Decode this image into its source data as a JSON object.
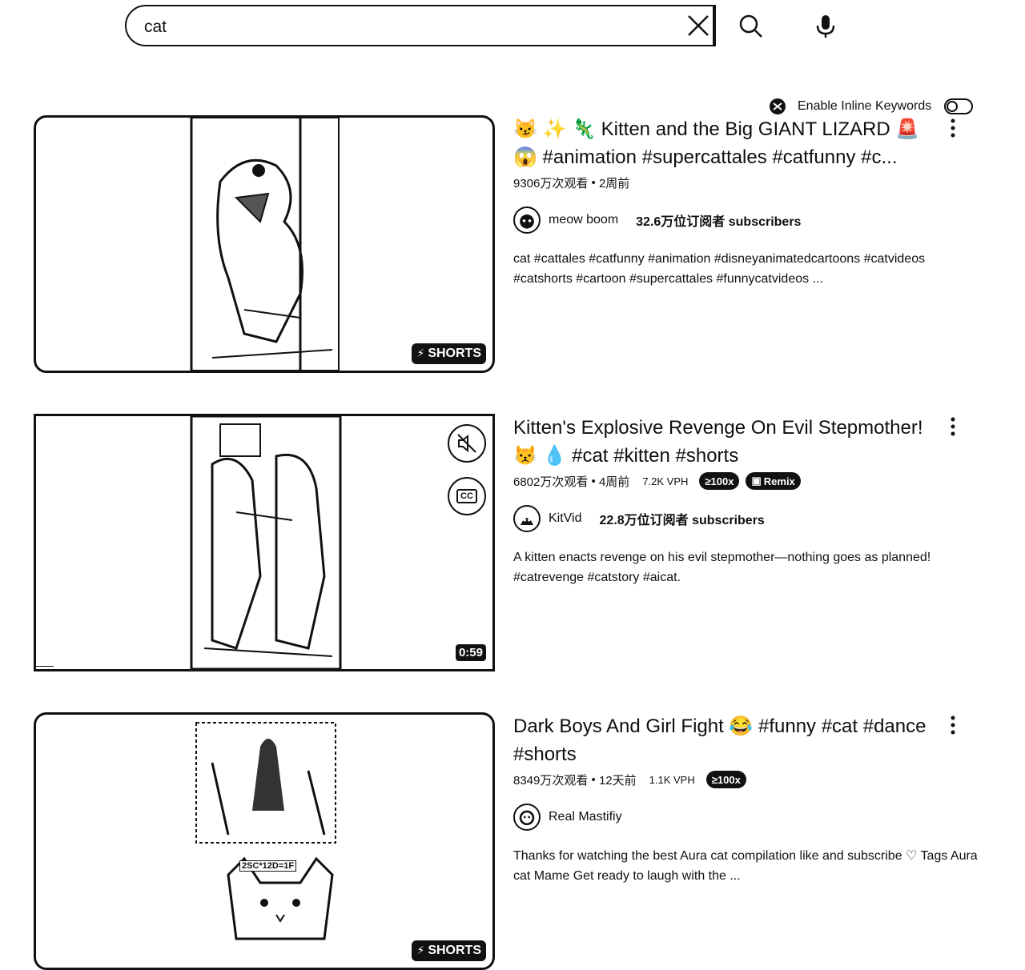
{
  "search": {
    "query": "cat"
  },
  "inline_keywords": {
    "label": "Enable Inline Keywords",
    "enabled": false
  },
  "results": [
    {
      "title": "😼 ✨ 🦎 Kitten and the Big GIANT LIZARD 🚨 😱 #animation #supercattales #catfunny #c...",
      "views": "9306万次观看",
      "age": "2周前",
      "channel": "meow boom",
      "subscribers": "32.6万位订阅者 subscribers",
      "description": "cat #cattales #catfunny #animation #disneyanimatedcartoons #catvideos #catshorts #cartoon #supercattales #funnycatvideos ...",
      "badge": "SHORTS"
    },
    {
      "title": "Kitten's Explosive Revenge On Evil Stepmother! 😾 💧 #cat #kitten #shorts",
      "views": "6802万次观看",
      "age": "4周前",
      "vph": "7.2K VPH",
      "pills": [
        "≥100x",
        "Remix"
      ],
      "channel": "KitVid",
      "subscribers": "22.8万位订阅者 subscribers",
      "description": "A kitten enacts revenge on his evil stepmother—nothing goes as planned! #catrevenge #catstory #aicat.",
      "duration": "0:59",
      "cc_label": "CC"
    },
    {
      "title": "Dark Boys And Girl Fight 😂 #funny #cat #dance #shorts",
      "views": "8349万次观看",
      "age": "12天前",
      "vph": "1.1K VPH",
      "pills": [
        "≥100x"
      ],
      "channel": "Real Mastifiy",
      "description": "Thanks for watching the best Aura cat compilation like and subscribe ♡ Tags Aura cat Mame Get ready to laugh with the ...",
      "badge": "SHORTS",
      "thumb_caption": "2SC*12D=1F"
    }
  ]
}
